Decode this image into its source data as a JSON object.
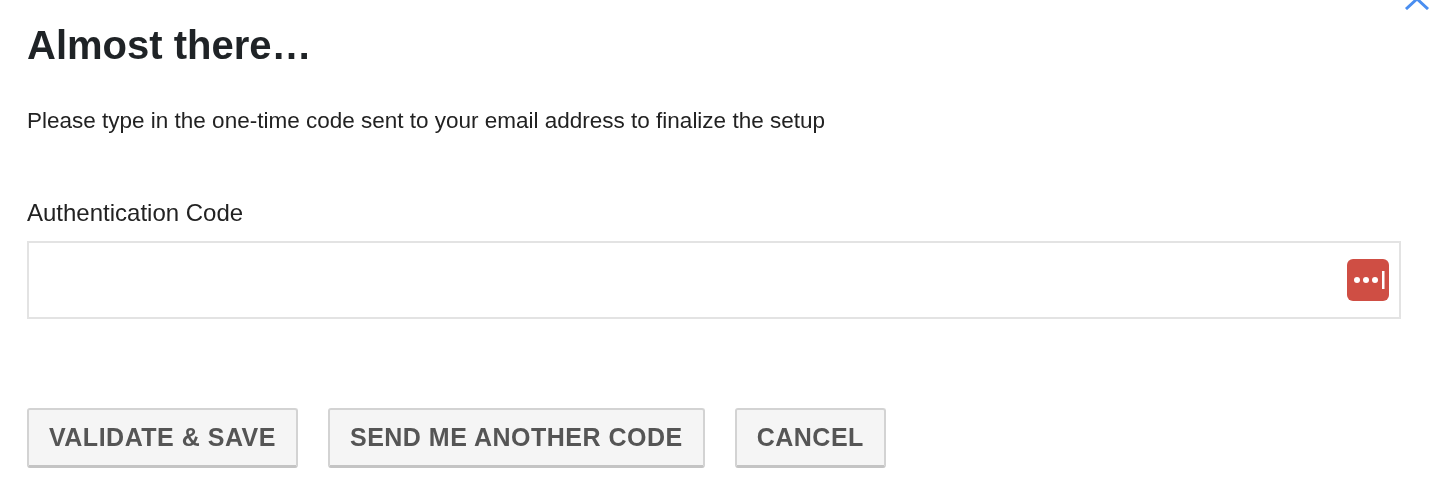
{
  "title": "Almost there…",
  "instructions": "Please type in the one-time code sent to your email address to finalize the setup",
  "field": {
    "label": "Authentication Code"
  },
  "buttons": [
    {
      "label": "VALIDATE & SAVE"
    },
    {
      "label": "SEND ME ANOTHER CODE"
    },
    {
      "label": "CANCEL"
    }
  ]
}
